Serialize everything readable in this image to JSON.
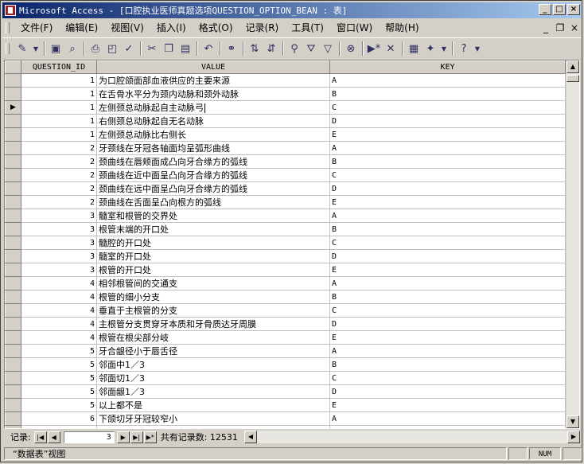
{
  "window": {
    "title": "Microsoft Access - [口腔执业医师真题选项QUESTION_OPTION_BEAN : 表]",
    "minimize": "_",
    "maximize": "□",
    "close": "×"
  },
  "menu": {
    "items": [
      {
        "label": "文件(F)"
      },
      {
        "label": "编辑(E)"
      },
      {
        "label": "视图(V)"
      },
      {
        "label": "插入(I)"
      },
      {
        "label": "格式(O)"
      },
      {
        "label": "记录(R)"
      },
      {
        "label": "工具(T)"
      },
      {
        "label": "窗口(W)"
      },
      {
        "label": "帮助(H)"
      }
    ],
    "child_min": "_",
    "child_restore": "❐",
    "child_close": "×"
  },
  "toolbar": {
    "icons": [
      "view-icon",
      "save-icon",
      "search-file-icon",
      "print-icon",
      "print-preview-icon",
      "spelling-icon",
      "cut-icon",
      "copy-icon",
      "paste-icon",
      "undo-icon",
      "hyperlink-icon",
      "sort-ascending-icon",
      "sort-descending-icon",
      "filter-by-selection-icon",
      "filter-by-form-icon",
      "apply-filter-icon",
      "find-icon",
      "new-record-icon",
      "delete-record-icon",
      "database-window-icon",
      "new-object-icon",
      "help-icon"
    ]
  },
  "table": {
    "columns": [
      "QUESTION_ID",
      "VALUE",
      "KEY"
    ],
    "current_row_index": 2,
    "rows": [
      {
        "id": "1",
        "value": "为口腔颌面部血液供应的主要来源",
        "key": "A"
      },
      {
        "id": "1",
        "value": "在舌骨水平分为颈内动脉和颈外动脉",
        "key": "B"
      },
      {
        "id": "1",
        "value": "左侧颈总动脉起自主动脉弓",
        "key": "C"
      },
      {
        "id": "1",
        "value": "右侧颈总动脉起自无名动脉",
        "key": "D"
      },
      {
        "id": "1",
        "value": "左侧颈总动脉比右侧长",
        "key": "E"
      },
      {
        "id": "2",
        "value": "牙颈线在牙冠各轴面均呈弧形曲线",
        "key": "A"
      },
      {
        "id": "2",
        "value": "颈曲线在唇颊面成凸向牙合缘方的弧线",
        "key": "B"
      },
      {
        "id": "2",
        "value": "颈曲线在近中面呈凸向牙合缘方的弧线",
        "key": "C"
      },
      {
        "id": "2",
        "value": "颈曲线在远中面呈凸向牙合缘方的弧线",
        "key": "D"
      },
      {
        "id": "2",
        "value": "颈曲线在舌面呈凸向根方的弧线",
        "key": "E"
      },
      {
        "id": "3",
        "value": "髓室和根管的交界处",
        "key": "A"
      },
      {
        "id": "3",
        "value": "根管末端的开口处",
        "key": "B"
      },
      {
        "id": "3",
        "value": "髓腔的开口处",
        "key": "C"
      },
      {
        "id": "3",
        "value": "髓室的开口处",
        "key": "D"
      },
      {
        "id": "3",
        "value": "根管的开口处",
        "key": "E"
      },
      {
        "id": "4",
        "value": "相邻根管间的交通支",
        "key": "A"
      },
      {
        "id": "4",
        "value": "根管的细小分支",
        "key": "B"
      },
      {
        "id": "4",
        "value": "垂直于主根管的分支",
        "key": "C"
      },
      {
        "id": "4",
        "value": "主根管分支贯穿牙本质和牙骨质达牙周膜",
        "key": "D"
      },
      {
        "id": "4",
        "value": "根管在根尖部分岐",
        "key": "E"
      },
      {
        "id": "5",
        "value": "牙合龈径小于唇舌径",
        "key": "A"
      },
      {
        "id": "5",
        "value": "邻面中1／3",
        "key": "B"
      },
      {
        "id": "5",
        "value": "邻面切1／3",
        "key": "C"
      },
      {
        "id": "5",
        "value": "邻面龈1／3",
        "key": "D"
      },
      {
        "id": "5",
        "value": "以上都不是",
        "key": "E"
      },
      {
        "id": "6",
        "value": "下颌切牙牙冠较窄小",
        "key": "A"
      },
      {
        "id": "6",
        "value": "下颌切牙牙冠唇面较光滑",
        "key": "B"
      },
      {
        "id": "6",
        "value": "下颌切牙牙根窄而扁",
        "key": "C"
      }
    ]
  },
  "navigation": {
    "label": "记录:",
    "current_record": "3",
    "first": "|◀",
    "prev": "◀",
    "next": "▶",
    "last": "▶|",
    "new": "▶*",
    "total_text": "共有记录数: 12531"
  },
  "status": {
    "view_text": "“数据表”视图",
    "num": "NUM"
  }
}
